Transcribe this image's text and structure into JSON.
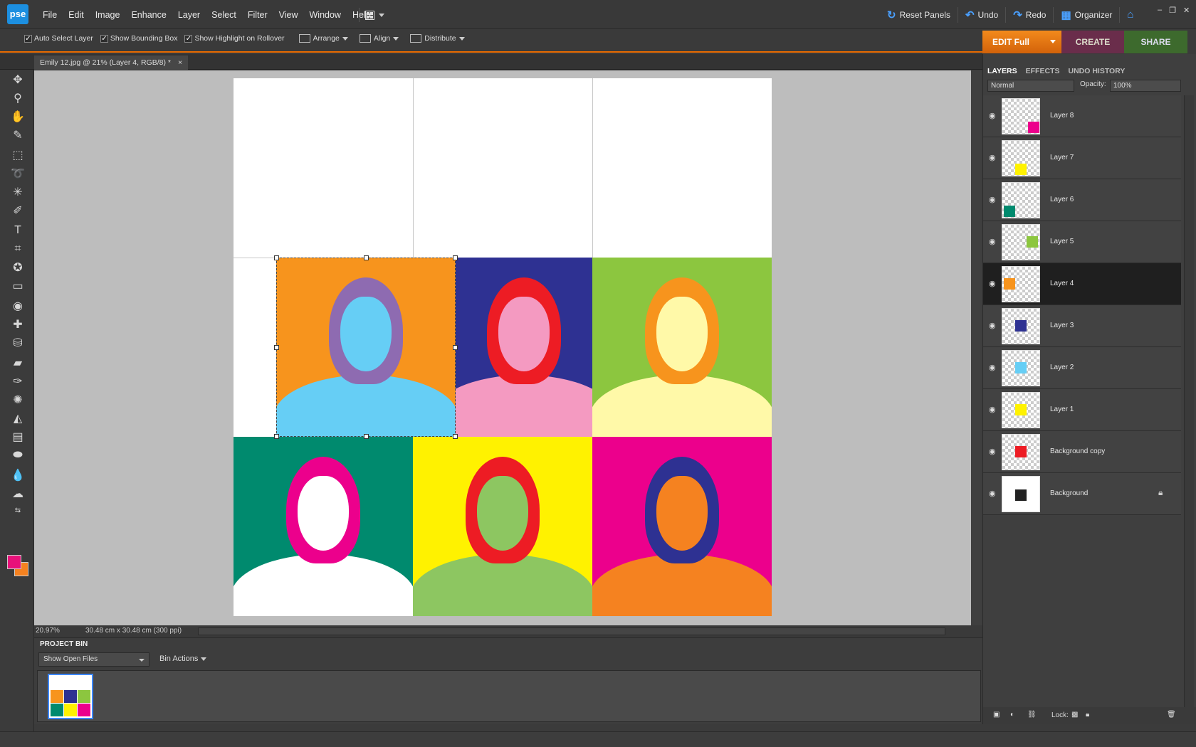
{
  "app": {
    "logo": "pse",
    "menus": [
      "File",
      "Edit",
      "Image",
      "Enhance",
      "Layer",
      "Select",
      "Filter",
      "View",
      "Window",
      "Help"
    ],
    "reset_panels": "Reset Panels",
    "undo": "Undo",
    "redo": "Redo",
    "organizer": "Organizer"
  },
  "options": {
    "auto_select": "Auto Select Layer",
    "bounding_box": "Show Bounding Box",
    "highlight": "Show Highlight on Rollover",
    "arrange": "Arrange",
    "align": "Align",
    "distribute": "Distribute"
  },
  "modes": {
    "edit": "EDIT Full",
    "create": "CREATE",
    "share": "SHARE"
  },
  "document": {
    "tab_title": "Emily 12.jpg @ 21% (Layer 4, RGB/8) *",
    "close": "×",
    "zoom": "20.97%",
    "size": "30.48 cm x 30.48 cm (300 ppi)"
  },
  "artwork": {
    "cells": [
      {
        "row": 1,
        "col": 0,
        "bg": "#f7941d",
        "hair": "#8e6bb1",
        "face": "#66cef5",
        "shirt": "#66cef5"
      },
      {
        "row": 1,
        "col": 1,
        "bg": "#2e3192",
        "hair": "#ed1c24",
        "face": "#f49ac1",
        "shirt": "#f49ac1"
      },
      {
        "row": 1,
        "col": 2,
        "bg": "#8cc63f",
        "hair": "#f7941d",
        "face": "#fff9a8",
        "shirt": "#fff9a8"
      },
      {
        "row": 2,
        "col": 0,
        "bg": "#008a6e",
        "hair": "#ec008c",
        "face": "#ffffff",
        "shirt": "#ffffff"
      },
      {
        "row": 2,
        "col": 1,
        "bg": "#fff200",
        "hair": "#ed1c24",
        "face": "#8dc661",
        "shirt": "#8dc661"
      },
      {
        "row": 2,
        "col": 2,
        "bg": "#ec008c",
        "hair": "#2e3192",
        "face": "#f58220",
        "shirt": "#f58220"
      }
    ]
  },
  "project_bin": {
    "title": "PROJECT BIN",
    "show": "Show Open Files",
    "actions": "Bin Actions"
  },
  "layers_panel": {
    "tabs": [
      "LAYERS",
      "EFFECTS",
      "UNDO HISTORY"
    ],
    "blend_mode": "Normal",
    "opacity_label": "Opacity:",
    "opacity": "100%",
    "lock_label": "Lock:",
    "layers": [
      {
        "name": "Layer 8",
        "mini": "#ec008c",
        "selected": false
      },
      {
        "name": "Layer 7",
        "mini": "#fff200",
        "selected": false
      },
      {
        "name": "Layer 6",
        "mini": "#008a6e",
        "selected": false
      },
      {
        "name": "Layer 5",
        "mini": "#8cc63f",
        "selected": false
      },
      {
        "name": "Layer 4",
        "mini": "#f7941d",
        "selected": true
      },
      {
        "name": "Layer 3",
        "mini": "#2e3192",
        "selected": false
      },
      {
        "name": "Layer 2",
        "mini": "#66cef5",
        "selected": false
      },
      {
        "name": "Layer 1",
        "mini": "#fff200",
        "selected": false
      },
      {
        "name": "Background copy",
        "mini": "#ed1c24",
        "selected": false
      },
      {
        "name": "Background",
        "mini": "#222222",
        "selected": false,
        "locked": true
      }
    ]
  },
  "colors": {
    "accent": "#e86a00",
    "foreground": "#e8117a",
    "background": "#f58220"
  }
}
